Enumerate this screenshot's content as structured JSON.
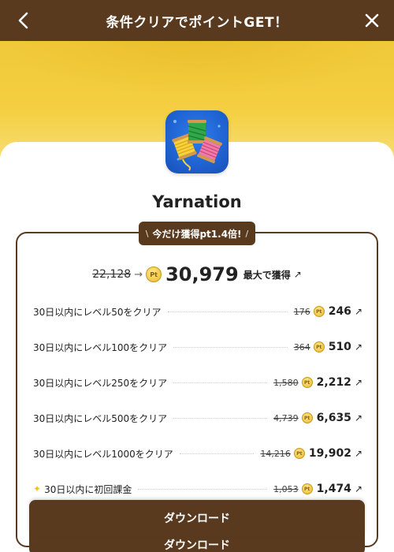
{
  "header": {
    "title": "条件クリアでポイントGET！"
  },
  "app": {
    "name": "Yarnation"
  },
  "badge": {
    "text": "今だけ獲得pt1.4倍!",
    "left_tick": "\\",
    "right_tick": "/"
  },
  "total": {
    "old_value": "22,128",
    "arrow": "→",
    "new_value": "30,979",
    "suffix": "最大で獲得",
    "link_icon": "↗"
  },
  "coin_label": "Pt",
  "tasks": [
    {
      "label": "30日以内にレベル50をクリア",
      "old": "176",
      "value": "246",
      "special": false
    },
    {
      "label": "30日以内にレベル100をクリア",
      "old": "364",
      "value": "510",
      "special": false
    },
    {
      "label": "30日以内にレベル250をクリア",
      "old": "1,580",
      "value": "2,212",
      "special": false
    },
    {
      "label": "30日以内にレベル500をクリア",
      "old": "4,739",
      "value": "6,635",
      "special": false
    },
    {
      "label": "30日以内にレベル1000をクリア",
      "old": "14,216",
      "value": "19,902",
      "special": false
    },
    {
      "label": "30日以内に初回課金",
      "old": "1,053",
      "value": "1,474",
      "special": true
    }
  ],
  "download": {
    "label": "ダウンロード",
    "label_behind": "ダウンロード"
  },
  "colors": {
    "brand_brown": "#5a3a1f",
    "hero_yellow": "#f0c93a",
    "coin_gold": "#e7b92c"
  }
}
